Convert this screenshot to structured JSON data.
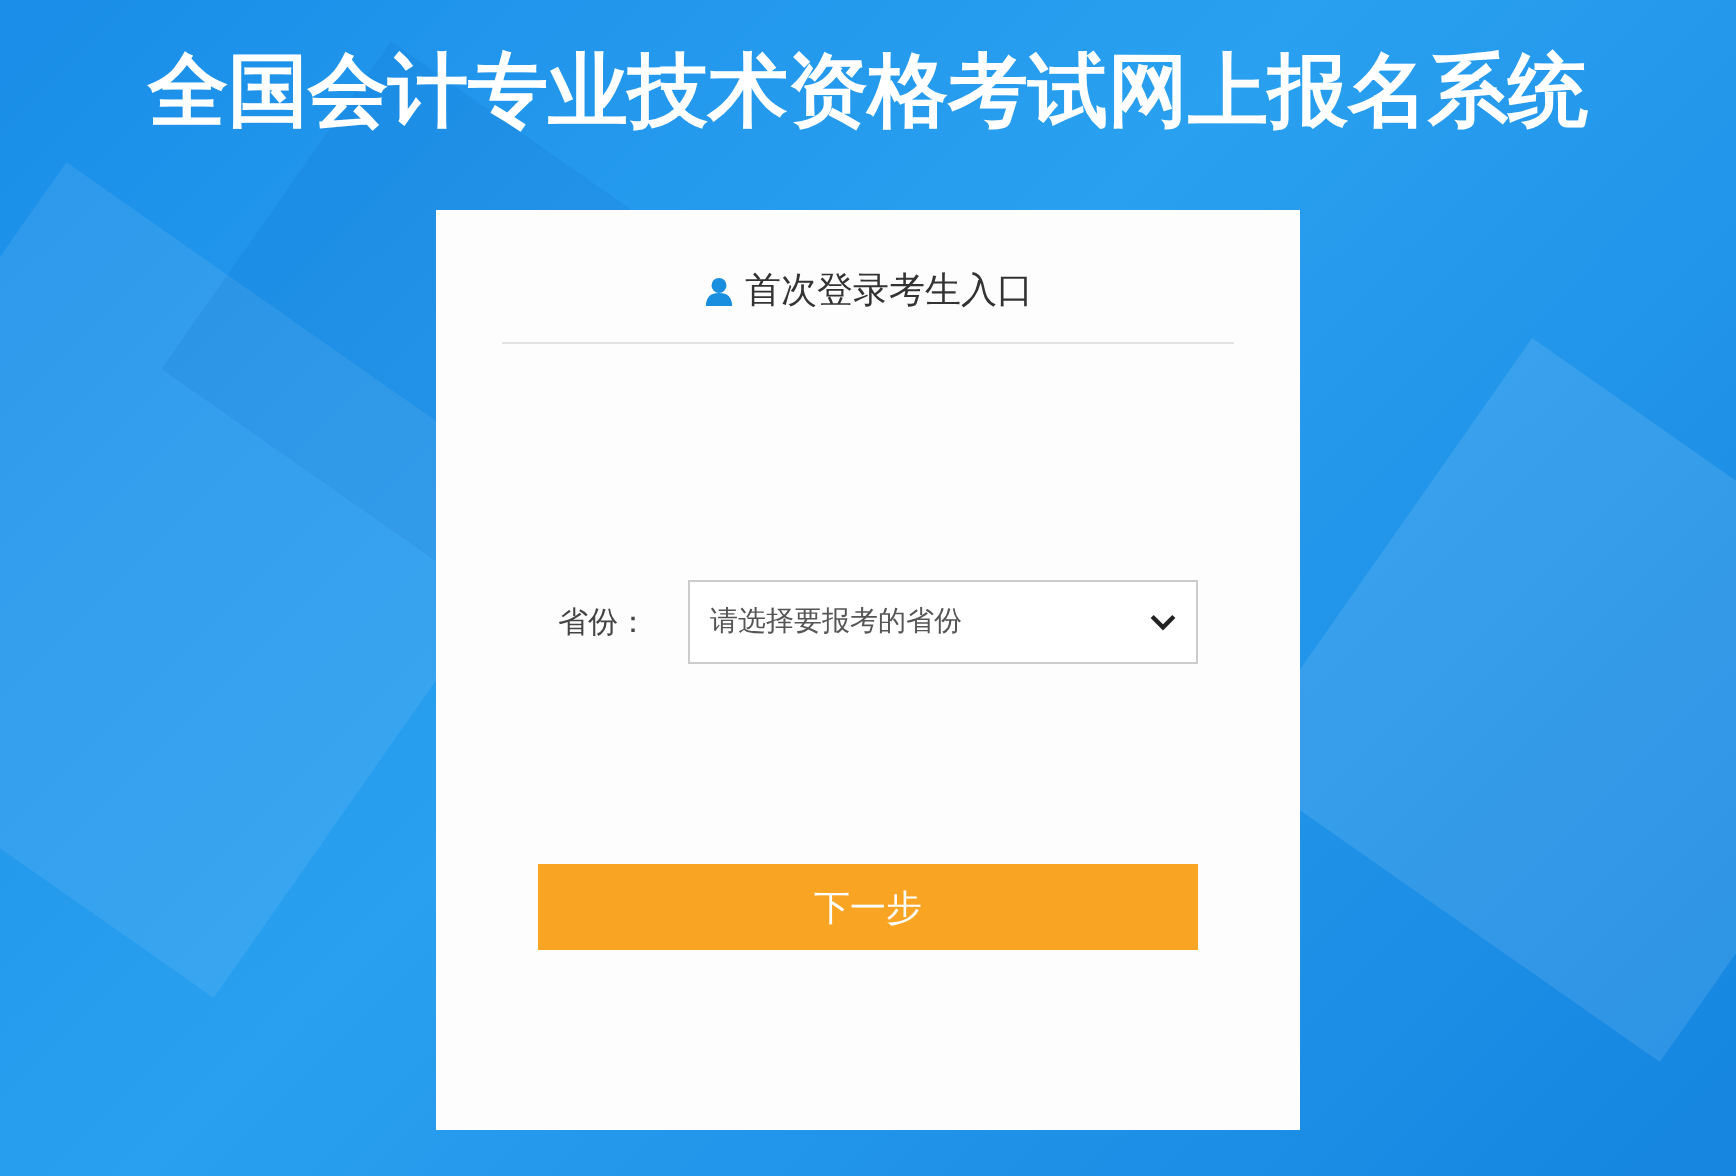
{
  "title": "全国会计专业技术资格考试网上报名系统",
  "card": {
    "heading": "首次登录考生入口",
    "province": {
      "label": "省份：",
      "placeholder": "请选择要报考的省份"
    },
    "button": "下一步"
  }
}
